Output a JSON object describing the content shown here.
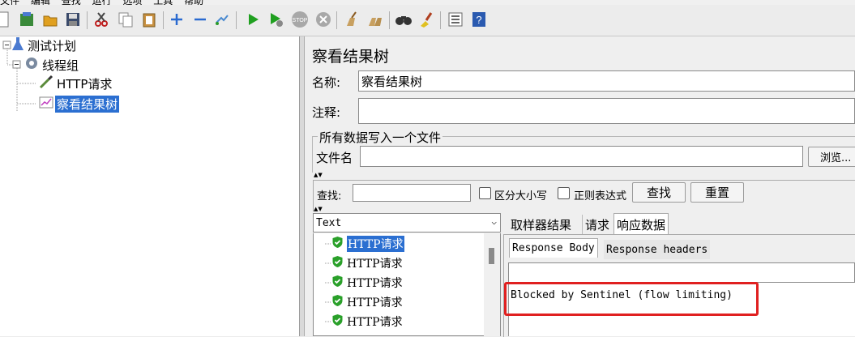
{
  "menu": [
    "文件",
    "编辑",
    "查找",
    "运行",
    "选项",
    "工具",
    "帮助"
  ],
  "toolbar": {
    "icons": [
      "new-icon",
      "templates-icon",
      "open-icon",
      "save-icon",
      "cut-icon",
      "copy-icon",
      "paste-icon",
      "expand-icon",
      "collapse-icon",
      "toggle-icon",
      "start-icon",
      "start-no-pause-icon",
      "stop-icon",
      "shutdown-icon",
      "clear-icon",
      "clear-all-icon",
      "search-icon",
      "reset-search-icon",
      "function-helper-icon",
      "help-icon"
    ]
  },
  "tree": {
    "test_plan": "测试计划",
    "thread_group": "线程组",
    "http_request": "HTTP请求",
    "result_tree": "察看结果树"
  },
  "panel": {
    "title": "察看结果树",
    "name_label": "名称:",
    "name_value": "察看结果树",
    "comment_label": "注释:",
    "comment_value": "",
    "file_group_title": "所有数据写入一个文件",
    "filename_label": "文件名",
    "filename_value": "",
    "browse_label": "浏览..."
  },
  "search": {
    "label": "查找:",
    "value": "",
    "case_label": "区分大小写",
    "regex_label": "正则表达式",
    "find_button": "查找",
    "reset_button": "重置"
  },
  "results": {
    "renderer": "Text",
    "items": [
      "HTTP请求",
      "HTTP请求",
      "HTTP请求",
      "HTTP请求",
      "HTTP请求"
    ]
  },
  "tabs": {
    "sampler_result": "取样器结果",
    "request": "请求",
    "response_data": "响应数据",
    "response_body": "Response Body",
    "response_headers": "Response headers"
  },
  "response": {
    "text": "Blocked by Sentinel (flow limiting)"
  },
  "colors": {
    "selection": "#2b6fd1",
    "highlight_box": "#e02020",
    "success": "#2aa02a"
  }
}
